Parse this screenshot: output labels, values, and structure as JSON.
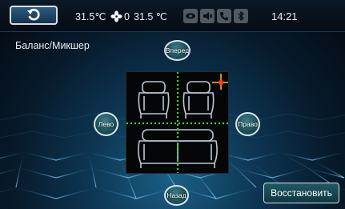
{
  "status_bar": {
    "temp_left": "31.5℃",
    "fan_speed": "0",
    "temp_right": "31.5 ℃",
    "clock": "14:21",
    "indicators": [
      "eye-icon",
      "mute-icon",
      "phone-icon",
      "bluetooth-icon"
    ]
  },
  "page": {
    "title": "Баланс/Микшер"
  },
  "balance": {
    "front_label": "Вперед",
    "left_label": "Лево",
    "right_label": "Право",
    "rear_label": "Назад"
  },
  "actions": {
    "restore_label": "Восстановить"
  },
  "colors": {
    "accent_green": "#3bd63b",
    "marker_red": "#ff3b1e",
    "marker_orange": "#ffb020",
    "seat_outline": "#b7c9d6",
    "button_teal": "#1c4d58",
    "indicator_gray": "#4f5a63"
  }
}
